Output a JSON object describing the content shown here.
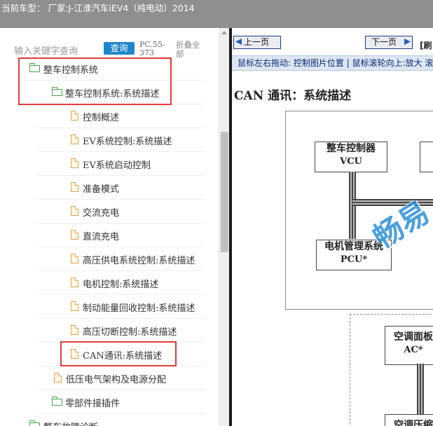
{
  "header": {
    "title": "当前车型： 厂家:J-江淮汽车iEV4（纯电动）2014"
  },
  "search": {
    "placeholder": "输入关键字查询",
    "button": "查询",
    "code": "PC.55-373",
    "collapse_all": "折叠全部"
  },
  "tree": {
    "nodes": [
      {
        "label": "整车控制系统",
        "icon": "folder-open-icon",
        "level": 1
      },
      {
        "label": "整车控制系统:系统描述",
        "icon": "folder-open-icon",
        "level": 2
      },
      {
        "label": "控制概述",
        "icon": "document-icon",
        "level": 3
      },
      {
        "label": "EV系统控制:系统描述",
        "icon": "document-icon",
        "level": 3
      },
      {
        "label": "EV系统启动控制",
        "icon": "document-icon",
        "level": 3
      },
      {
        "label": "准备模式",
        "icon": "document-icon",
        "level": 3
      },
      {
        "label": "交流充电",
        "icon": "document-icon",
        "level": 3
      },
      {
        "label": "直流充电",
        "icon": "document-icon",
        "level": 3
      },
      {
        "label": "高压供电系统控制:系统描述",
        "icon": "document-icon",
        "level": 3
      },
      {
        "label": "电机控制:系统描述",
        "icon": "document-icon",
        "level": 3
      },
      {
        "label": "制动能量回收控制:系统描述",
        "icon": "document-icon",
        "level": 3
      },
      {
        "label": "高压切断控制:系统描述",
        "icon": "document-icon",
        "level": 3
      },
      {
        "label": "CAN通讯:系统描述",
        "icon": "document-icon",
        "level": 3
      },
      {
        "label": "低压电气架构及电源分配",
        "icon": "document-icon",
        "level": 2
      },
      {
        "label": "零部件接插件",
        "icon": "folder-icon",
        "level": 2
      },
      {
        "label": "整车故障诊断",
        "icon": "folder-icon",
        "level": 1
      }
    ]
  },
  "viewer": {
    "prev": "上一页",
    "next": "下一页",
    "next_extra": "[刷",
    "hint": "鼠标左右拖动: 控制图片位置 | 鼠标滚轮向上:放大  滚",
    "doc_title": "CAN 通讯：系统描述",
    "diagram": {
      "vcu": {
        "line1": "整车控制器",
        "line2": "VCU"
      },
      "pcu": {
        "line1": "电机管理系统",
        "line2": "PCU*"
      },
      "ac": {
        "line1": "空调面板",
        "line2": "AC*"
      },
      "comp": {
        "line1": "空调压缩"
      }
    },
    "watermark": "畅易"
  },
  "colors": {
    "highlight": "#e23b3b",
    "accent": "#1f86c9",
    "folder": "#49a34b",
    "document": "#e0a347"
  }
}
